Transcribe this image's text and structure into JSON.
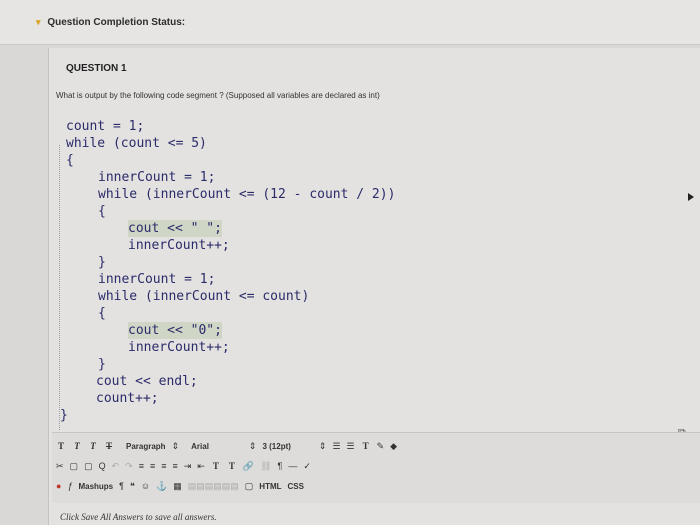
{
  "status": {
    "label": "Question Completion Status:"
  },
  "question": {
    "title": "QUESTION 1",
    "prompt": "What is output by the following code segment ? (Supposed all variables are declared as int)"
  },
  "code_lines": [
    "count = 1;",
    "while (count <= 5)",
    "{",
    "innerCount = 1;",
    "while (innerCount <= (12 - count / 2))",
    "{",
    "cout << \" \";",
    "innerCount++;",
    "}",
    "innerCount = 1;",
    "while (innerCount <= count)",
    "{",
    "cout << \"0\";",
    "innerCount++;",
    "}",
    "cout << endl;",
    "count++;",
    "}"
  ],
  "toolbar": {
    "row1": {
      "t1": "T",
      "t2": "T",
      "t3": "T",
      "t4": "T",
      "paragraph": "Paragraph",
      "font": "Arial",
      "size": "3 (12pt)",
      "list1": "☰",
      "list2": "☰",
      "text_color": "T"
    },
    "row2": {
      "cut": "✂",
      "copy": "▢",
      "paste": "▢",
      "find": "Q",
      "sup": "T",
      "sub": "T"
    },
    "row3": {
      "mashups": "Mashups",
      "paragraph_mark": "¶",
      "quote": "❝",
      "html": "HTML",
      "css": "CSS"
    }
  },
  "footer": {
    "text": "Click Save All Answers to save all answers."
  }
}
